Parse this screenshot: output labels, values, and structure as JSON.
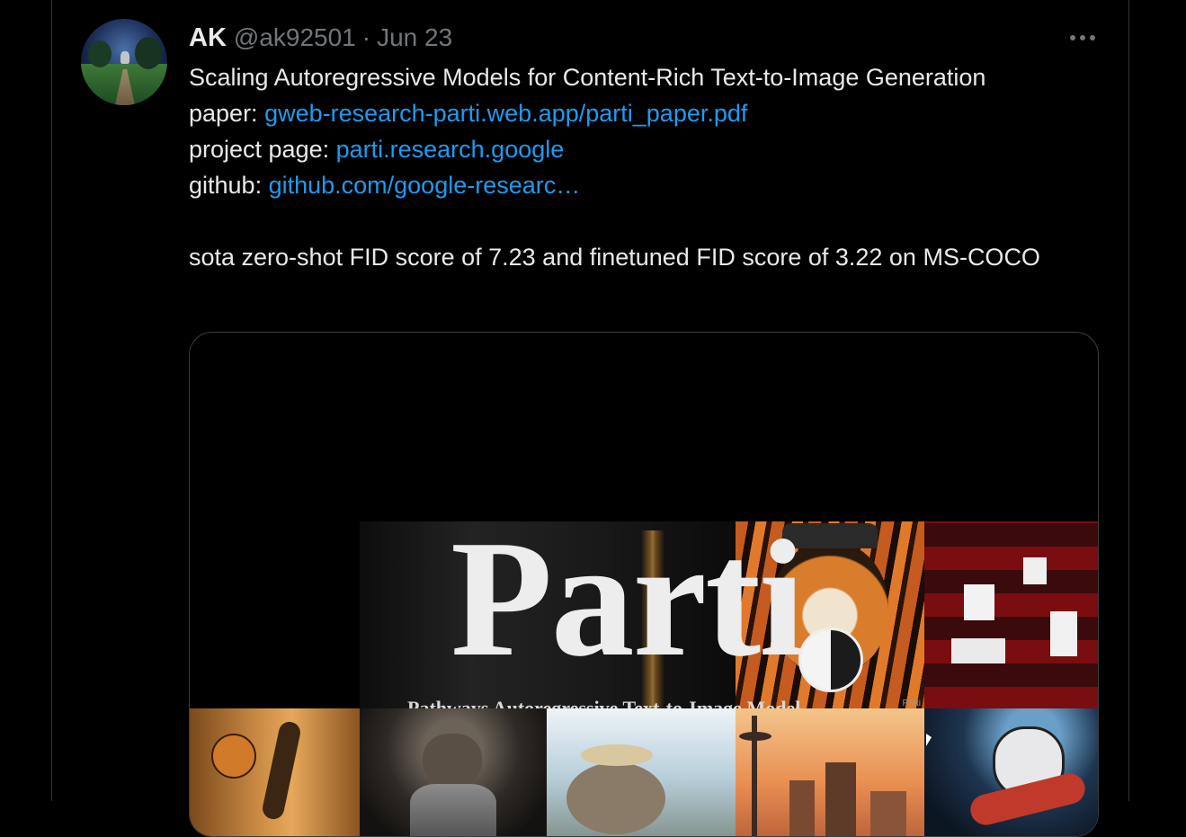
{
  "tweet": {
    "author_name": "AK",
    "handle": "@ak92501",
    "separator": "·",
    "date": "Jun 23",
    "title_line": "Scaling Autoregressive Models for Content-Rich Text-to-Image Generation",
    "paper_label": "paper: ",
    "paper_link": "gweb-research-parti.web.app/parti_paper.pdf",
    "project_label": "project page: ",
    "project_link": "parti.research.google",
    "github_label": "github: ",
    "github_link": "github.com/google-researc…",
    "fid_text": "sota zero-shot FID score of 7.23 and finetuned FID score of 3.22 on MS-COCO"
  },
  "media": {
    "title": "Parti",
    "subtitle": "Pathways Autoregressive Text-to-Image Model",
    "watermark": "Parti"
  },
  "colors": {
    "background": "#000000",
    "text": "#e7e9ea",
    "muted": "#71767b",
    "link": "#1d9bf0",
    "border": "#2f3336"
  },
  "icons": {
    "more": "more-options-icon",
    "cursor": "mouse-cursor-icon"
  }
}
